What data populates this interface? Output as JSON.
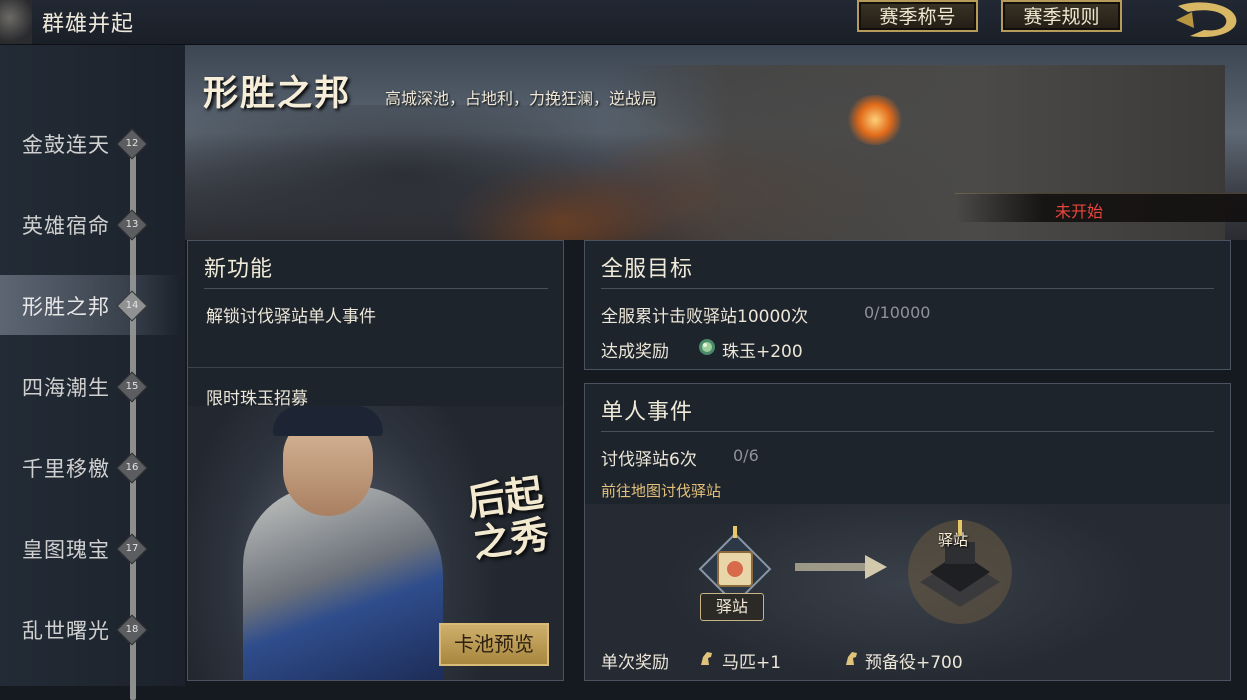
{
  "header": {
    "title": "群雄并起",
    "buttons": {
      "season_title": "赛季称号",
      "season_rules": "赛季规则"
    }
  },
  "sidebar": {
    "items": [
      {
        "label": "金鼓连天",
        "num": "12",
        "active": false
      },
      {
        "label": "英雄宿命",
        "num": "13",
        "active": false
      },
      {
        "label": "形胜之邦",
        "num": "14",
        "active": true
      },
      {
        "label": "四海潮生",
        "num": "15",
        "active": false
      },
      {
        "label": "千里移檄",
        "num": "16",
        "active": false
      },
      {
        "label": "皇图瑰宝",
        "num": "17",
        "active": false
      },
      {
        "label": "乱世曙光",
        "num": "18",
        "active": false
      }
    ]
  },
  "banner": {
    "title": "形胜之邦",
    "subtitle": "高城深池，占地利，力挽狂澜，逆战局",
    "status": "未开始",
    "status_color": "#e8453c"
  },
  "new_feature": {
    "title": "新功能",
    "item": "解锁讨伐驿站单人事件",
    "gacha_title": "限时珠玉招募",
    "hero_caption": "后起之秀",
    "preview_button": "卡池预览"
  },
  "server_goal": {
    "title": "全服目标",
    "task": "全服累计击败驿站10000次",
    "progress": "0/10000",
    "reward_label": "达成奖励",
    "reward": {
      "icon": "jade-icon",
      "text": "珠玉+200"
    }
  },
  "solo_event": {
    "title": "单人事件",
    "task": "讨伐驿站6次",
    "progress": "0/6",
    "link": "前往地图讨伐驿站",
    "post_tag": "驿站",
    "station_label": "驿站",
    "reward_label": "单次奖励",
    "rewards": [
      {
        "icon": "horse-icon",
        "text": "马匹+1"
      },
      {
        "icon": "reserve-icon",
        "text": "预备役+700"
      }
    ]
  },
  "colors": {
    "accent_gold": "#b79b5a",
    "link_gold": "#e4c07a"
  }
}
